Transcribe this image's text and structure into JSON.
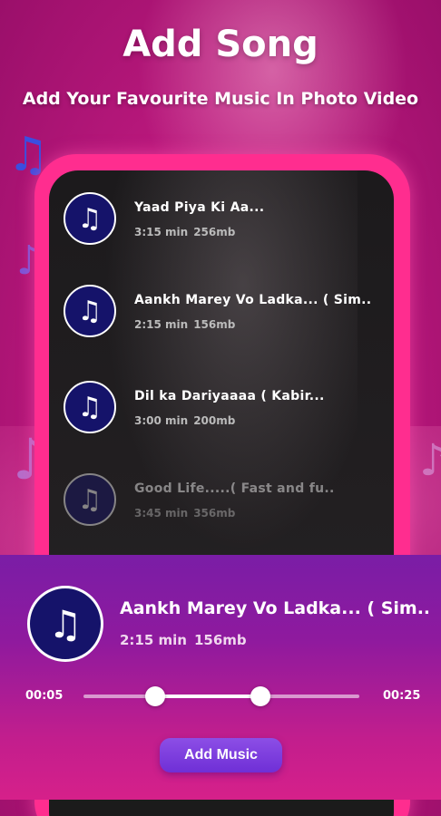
{
  "header": {
    "title": "Add Song",
    "subtitle": "Add Your Favourite Music In Photo Video"
  },
  "songs": [
    {
      "title": "Yaad Piya Ki Aa...",
      "duration": "3:15 min",
      "size": "256mb"
    },
    {
      "title": "Aankh Marey Vo Ladka... ( Sim..",
      "duration": "2:15 min",
      "size": "156mb"
    },
    {
      "title": "Dil ka Dariyaaaa ( Kabir...",
      "duration": "3:00 min",
      "size": "200mb"
    },
    {
      "title": "Good Life.....( Fast and fu..",
      "duration": "3:45 min",
      "size": "356mb"
    }
  ],
  "player": {
    "title": "Aankh Marey Vo Ladka... ( Sim..",
    "duration": "2:15 min",
    "size": "156mb",
    "start_time": "00:05",
    "end_time": "00:25",
    "range_start_fraction": 0.26,
    "range_end_fraction": 0.64
  },
  "actions": {
    "add_music_label": "Add Music"
  },
  "icons": {
    "music_note": "♫",
    "treble_clef": "𝄞",
    "eighth_note": "♪"
  },
  "colors": {
    "accent": "#ff2d8f",
    "icon_bg": "#15136a",
    "button": "#7b3ce0"
  }
}
